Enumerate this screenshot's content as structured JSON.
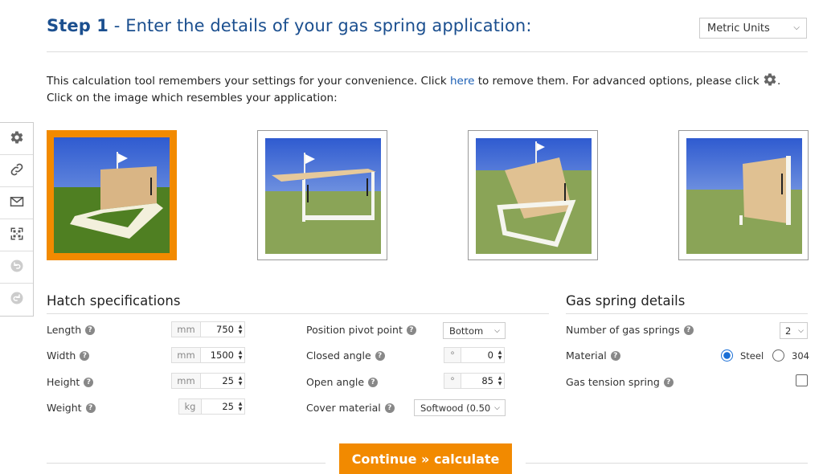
{
  "header": {
    "step_label": "Step 1",
    "title_rest": " - Enter the details of your gas spring application:",
    "units_select": "Metric Units"
  },
  "info": {
    "line1_before": "This calculation tool remembers your settings for your convenience. Click ",
    "line1_link": "here",
    "line1_after": " to remove them. For advanced options, please click ",
    "line1_end": ".",
    "line2": "Click on the image which resembles your application:"
  },
  "sidebar_tools": [
    "gear-icon",
    "link-icon",
    "mail-icon",
    "qr-code-icon",
    "undo-icon",
    "redo-icon"
  ],
  "applications": {
    "selected_index": 0,
    "accent": "#f28a00"
  },
  "hatch": {
    "title": "Hatch specifications",
    "length": {
      "label": "Length",
      "unit": "mm",
      "value": "750"
    },
    "width": {
      "label": "Width",
      "unit": "mm",
      "value": "1500"
    },
    "height": {
      "label": "Height",
      "unit": "mm",
      "value": "25"
    },
    "weight": {
      "label": "Weight",
      "unit": "kg",
      "value": "25"
    },
    "pivot": {
      "label": "Position pivot point",
      "value": "Bottom"
    },
    "closed": {
      "label": "Closed angle",
      "unit": "°",
      "value": "0"
    },
    "open": {
      "label": "Open angle",
      "unit": "°",
      "value": "85"
    },
    "cover": {
      "label": "Cover material",
      "value": "Softwood (0.50"
    }
  },
  "gas": {
    "title": "Gas spring details",
    "count": {
      "label": "Number of gas springs",
      "value": "2"
    },
    "material": {
      "label": "Material",
      "option1": "Steel",
      "option2": "304",
      "selected": "Steel"
    },
    "tension": {
      "label": "Gas tension spring",
      "checked": false
    }
  },
  "continue_label": "Continue » calculate"
}
